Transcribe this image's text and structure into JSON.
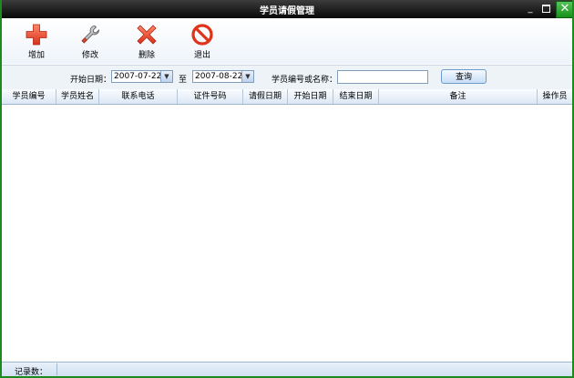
{
  "window": {
    "title": "学员请假管理",
    "min_glyph": "_",
    "close_glyph": "✕"
  },
  "toolbar": {
    "add": "增加",
    "edit": "修改",
    "delete": "删除",
    "exit": "退出"
  },
  "filter": {
    "start_label": "开始日期：",
    "start_value": "2007-07-22",
    "to_label": "至",
    "end_value": "2007-08-22",
    "search_label": "学员编号或名称：",
    "search_value": "",
    "query_button": "查询"
  },
  "table": {
    "columns": [
      "学员编号",
      "学员姓名",
      "联系电话",
      "证件号码",
      "请假日期",
      "开始日期",
      "结束日期",
      "备注",
      "操作员"
    ],
    "rows": []
  },
  "status": {
    "record_count_label": "记录数："
  },
  "colors": {
    "accent_red": "#e8412c",
    "title_bg": "#1a1a1a",
    "frame_green": "#1d8a1d"
  }
}
